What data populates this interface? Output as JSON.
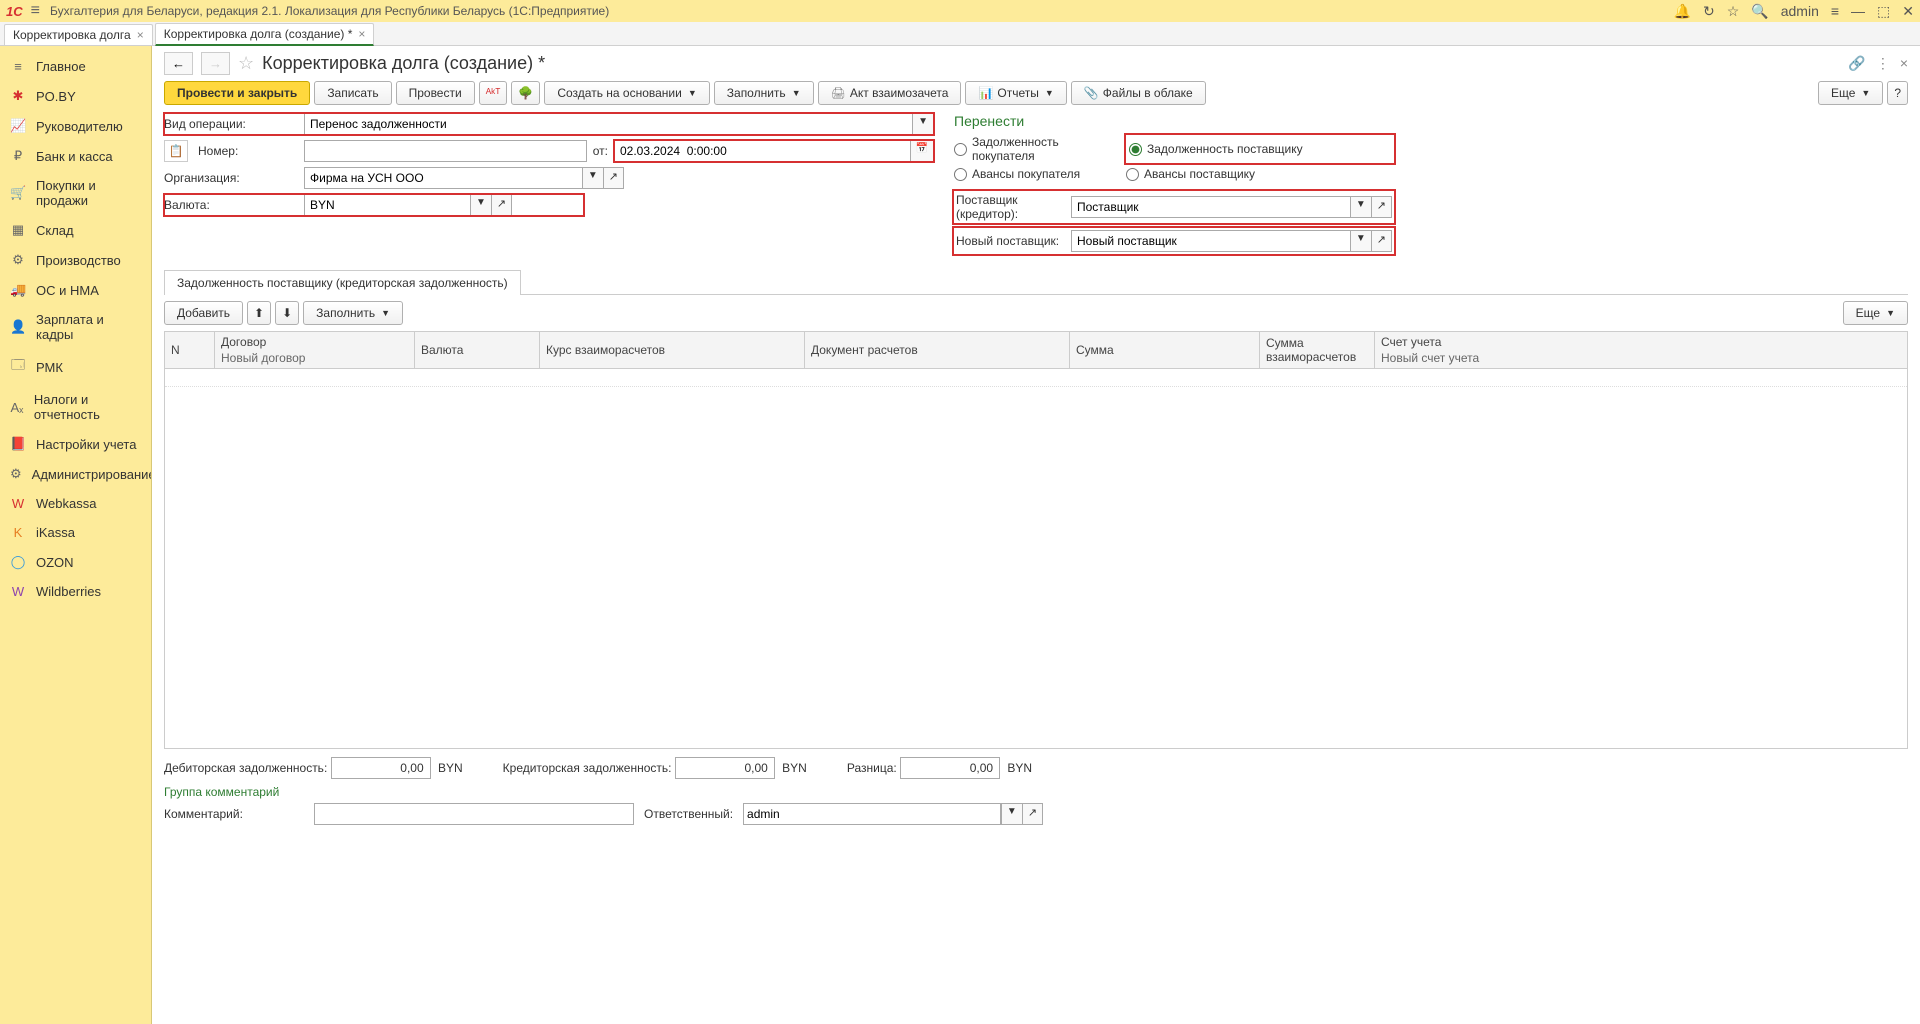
{
  "app": {
    "title": "Бухгалтерия для Беларуси, редакция 2.1. Локализация для Республики Беларусь   (1С:Предприятие)",
    "user": "admin",
    "logo": "1C"
  },
  "tabs": [
    {
      "label": "Корректировка долга"
    },
    {
      "label": "Корректировка долга (создание) *",
      "active": true
    }
  ],
  "sidebar": [
    {
      "label": "Главное",
      "icon": "≡",
      "color": ""
    },
    {
      "label": "PO.BY",
      "icon": "✱",
      "color": "red"
    },
    {
      "label": "Руководителю",
      "icon": "📈",
      "color": ""
    },
    {
      "label": "Банк и касса",
      "icon": "₽",
      "color": ""
    },
    {
      "label": "Покупки и продажи",
      "icon": "🛒",
      "color": ""
    },
    {
      "label": "Склад",
      "icon": "▦",
      "color": ""
    },
    {
      "label": "Производство",
      "icon": "⚙",
      "color": ""
    },
    {
      "label": "ОС и НМА",
      "icon": "🚚",
      "color": ""
    },
    {
      "label": "Зарплата и кадры",
      "icon": "👤",
      "color": ""
    },
    {
      "label": "РМК",
      "icon": "🗔",
      "color": ""
    },
    {
      "label": "Налоги и отчетность",
      "icon": "Aₓ",
      "color": ""
    },
    {
      "label": "Настройки учета",
      "icon": "📕",
      "color": ""
    },
    {
      "label": "Администрирование",
      "icon": "⚙",
      "color": ""
    },
    {
      "label": "Webkassa",
      "icon": "W",
      "color": "red"
    },
    {
      "label": "iKassa",
      "icon": "K",
      "color": "orange"
    },
    {
      "label": "OZON",
      "icon": "◯",
      "color": "blue"
    },
    {
      "label": "Wildberries",
      "icon": "W",
      "color": "purple"
    }
  ],
  "page": {
    "title": "Корректировка долга (создание) *",
    "toolbar": {
      "post_close": "Провести и закрыть",
      "save": "Записать",
      "post": "Провести",
      "create_based": "Создать на основании",
      "fill": "Заполнить",
      "act": "Акт взаимозачета",
      "reports": "Отчеты",
      "files": "Файлы в облаке",
      "more": "Еще"
    }
  },
  "form": {
    "op_type_label": "Вид операции:",
    "op_type_value": "Перенос задолженности",
    "number_label": "Номер:",
    "number_value": "",
    "date_label": "от:",
    "date_value": "02.03.2024  0:00:00",
    "org_label": "Организация:",
    "org_value": "Фирма на УСН ООО",
    "currency_label": "Валюта:",
    "currency_value": "BYN",
    "transfer_header": "Перенести",
    "radio": {
      "buyer_debt": "Задолженность покупателя",
      "supplier_debt": "Задолженность поставщику",
      "buyer_adv": "Авансы покупателя",
      "supplier_adv": "Авансы поставщику"
    },
    "supplier_label": "Поставщик (кредитор):",
    "supplier_value": "Поставщик",
    "new_supplier_label": "Новый поставщик:",
    "new_supplier_value": "Новый поставщик"
  },
  "tab_panel": {
    "tab_label": "Задолженность поставщику (кредиторская задолженность)",
    "add_btn": "Добавить",
    "fill_btn": "Заполнить",
    "more_btn": "Еще",
    "columns": {
      "n": "N",
      "contract": "Договор",
      "contract_sub": "Новый договор",
      "currency": "Валюта",
      "rate": "Курс взаиморасчетов",
      "doc": "Документ расчетов",
      "sum": "Сумма",
      "sum_settle": "Сумма взаиморасчетов",
      "account": "Счет учета",
      "account_sub": "Новый счет учета"
    }
  },
  "totals": {
    "debit_label": "Дебиторская задолженность:",
    "debit_value": "0,00",
    "credit_label": "Кредиторская задолженность:",
    "credit_value": "0,00",
    "diff_label": "Разница:",
    "diff_value": "0,00",
    "ccy": "BYN",
    "comment_group": "Группа комментарий",
    "comment_label": "Комментарий:",
    "comment_value": "",
    "responsible_label": "Ответственный:",
    "responsible_value": "admin"
  }
}
